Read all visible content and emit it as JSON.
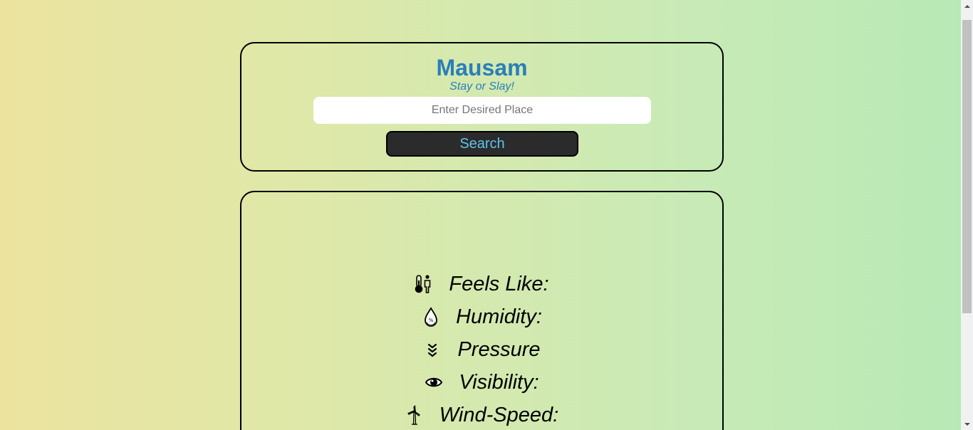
{
  "app": {
    "title": "Mausam",
    "tagline": "Stay or Slay!"
  },
  "search": {
    "placeholder": "Enter Desired Place",
    "value": "",
    "button_label": "Search"
  },
  "weather": {
    "stats": [
      {
        "label": "Feels Like:",
        "icon": "thermometer-person-icon"
      },
      {
        "label": "Humidity:",
        "icon": "water-drop-percent-icon"
      },
      {
        "label": "Pressure",
        "icon": "triple-chevron-down-icon"
      },
      {
        "label": "Visibility:",
        "icon": "eye-icon"
      },
      {
        "label": "Wind-Speed:",
        "icon": "wind-turbine-icon"
      }
    ]
  },
  "colors": {
    "brand": "#2a7fb8",
    "button_bg": "#2b2b2b",
    "button_text": "#5ec3f0"
  }
}
